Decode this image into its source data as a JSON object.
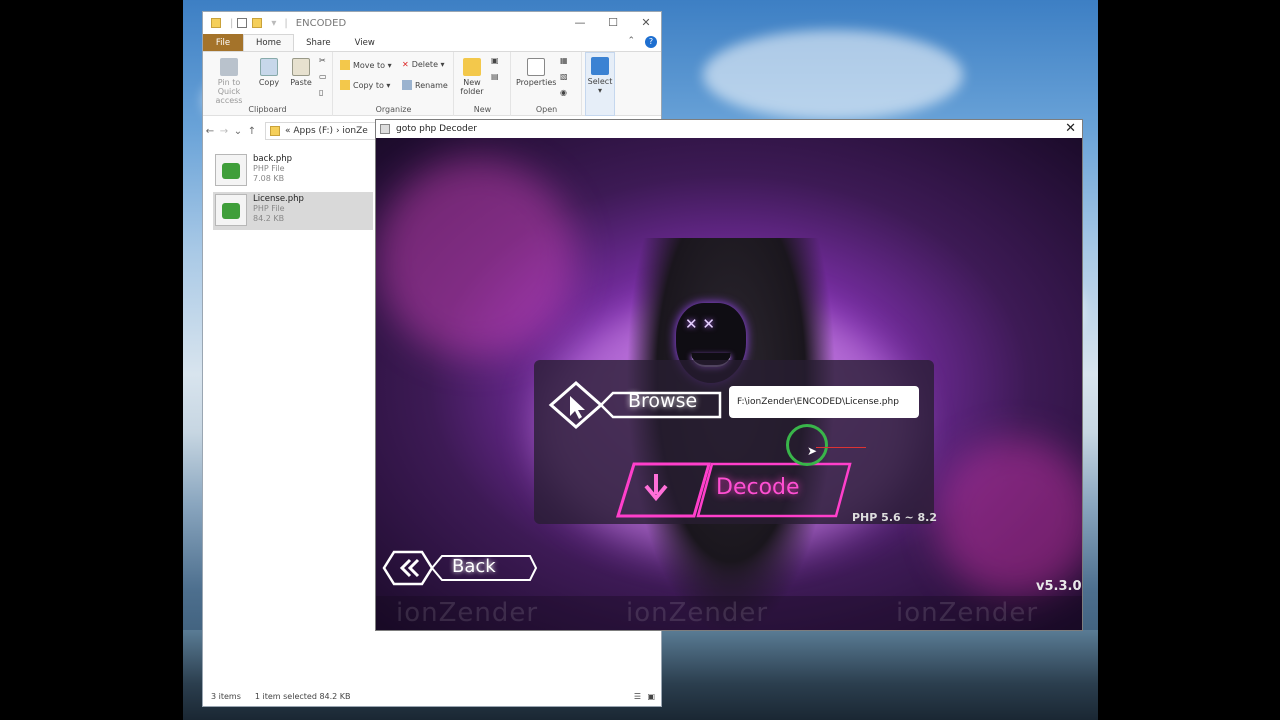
{
  "explorer": {
    "title": "ENCODED",
    "tabs": [
      "File",
      "Home",
      "Share",
      "View"
    ],
    "ribbon": {
      "clipboard": {
        "pin_label": "Pin to Quick access",
        "copy_label": "Copy",
        "paste_label": "Paste",
        "group_label": "Clipboard"
      },
      "organize": {
        "move_to": "Move to",
        "copy_to": "Copy to",
        "delete": "Delete",
        "rename": "Rename",
        "group_label": "Organize"
      },
      "new": {
        "new_folder": "New folder",
        "group_label": "New"
      },
      "open": {
        "properties": "Properties",
        "group_label": "Open"
      },
      "select": {
        "select_label": "Select"
      }
    },
    "address": {
      "prefix": "«",
      "part1": "Apps (F:)",
      "sep": "›",
      "part2": "ionZe"
    },
    "files": [
      {
        "name": "back.php",
        "type": "PHP File",
        "size": "7.08 KB",
        "selected": false
      },
      {
        "name": "License.php",
        "type": "PHP File",
        "size": "84.2 KB",
        "selected": true
      }
    ],
    "status": {
      "count": "3 items",
      "selection": "1 item selected  84.2 KB"
    }
  },
  "decoder": {
    "title": "goto php Decoder",
    "close": "✕",
    "browse_label": "Browse",
    "path_value": "F:\\ionZender\\ENCODED\\License.php",
    "decode_label": "Decode",
    "php_version": "PHP 5.6 ~ 8.2",
    "back_label": "Back",
    "app_version": "v5.3.0",
    "brand_text": [
      "ionZender",
      "ionZender",
      "ionZender"
    ]
  },
  "colors": {
    "decode_accent": "#ff3fcb",
    "file_tab": "#a4732a",
    "cursor_ring": "#39b54a"
  }
}
